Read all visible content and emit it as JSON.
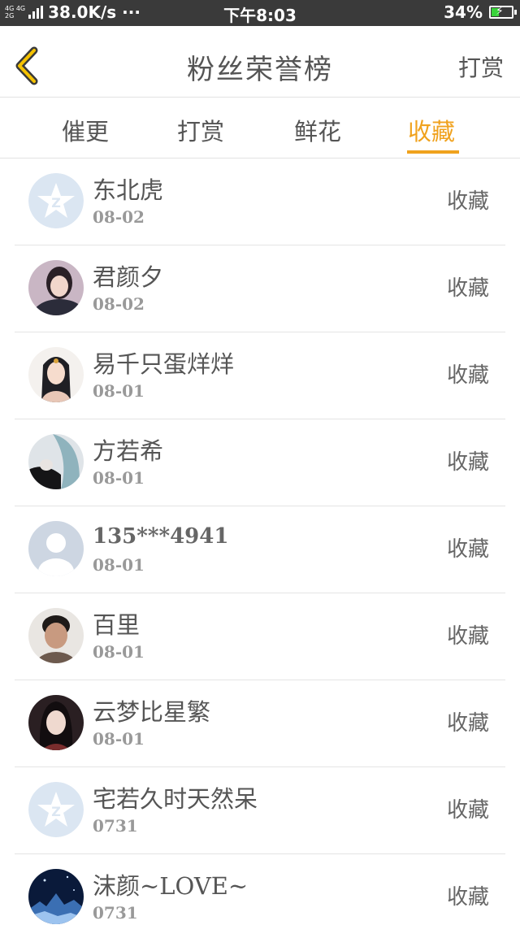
{
  "status_bar": {
    "network_top": "4G 4G",
    "network_bottom": "2G",
    "speed": "38.0K/s ···",
    "time": "下午8:03",
    "battery": "34%",
    "battery_level": 0.34,
    "battery_color": "#39d33a"
  },
  "header": {
    "back_icon": "chevron-left-icon",
    "title": "粉丝荣誉榜",
    "right_action": "打赏"
  },
  "tabs": [
    {
      "label": "催更",
      "active": false
    },
    {
      "label": "打赏",
      "active": false
    },
    {
      "label": "鲜花",
      "active": false
    },
    {
      "label": "收藏",
      "active": true
    }
  ],
  "accent_color": "#f0a21e",
  "fans": [
    {
      "name": "东北虎",
      "date": "08-02",
      "action": "收藏",
      "avatar": "default-star-avatar"
    },
    {
      "name": "君颜夕",
      "date": "08-02",
      "action": "收藏",
      "avatar": "photo-avatar"
    },
    {
      "name": "易千只蛋烊烊",
      "date": "08-01",
      "action": "收藏",
      "avatar": "anime-girl-avatar"
    },
    {
      "name": "方若希",
      "date": "08-01",
      "action": "收藏",
      "avatar": "anime-couple-avatar"
    },
    {
      "name": "135***4941",
      "date": "08-01",
      "action": "收藏",
      "avatar": "default-person-avatar"
    },
    {
      "name": "百里",
      "date": "08-01",
      "action": "收藏",
      "avatar": "photo-avatar"
    },
    {
      "name": "云梦比星繁",
      "date": "08-01",
      "action": "收藏",
      "avatar": "anime-avatar"
    },
    {
      "name": "宅若久时天然呆",
      "date": "0731",
      "action": "收藏",
      "avatar": "default-star-avatar"
    },
    {
      "name": "沫颜~LOVE~",
      "date": "0731",
      "action": "收藏",
      "avatar": "night-scene-avatar"
    }
  ]
}
